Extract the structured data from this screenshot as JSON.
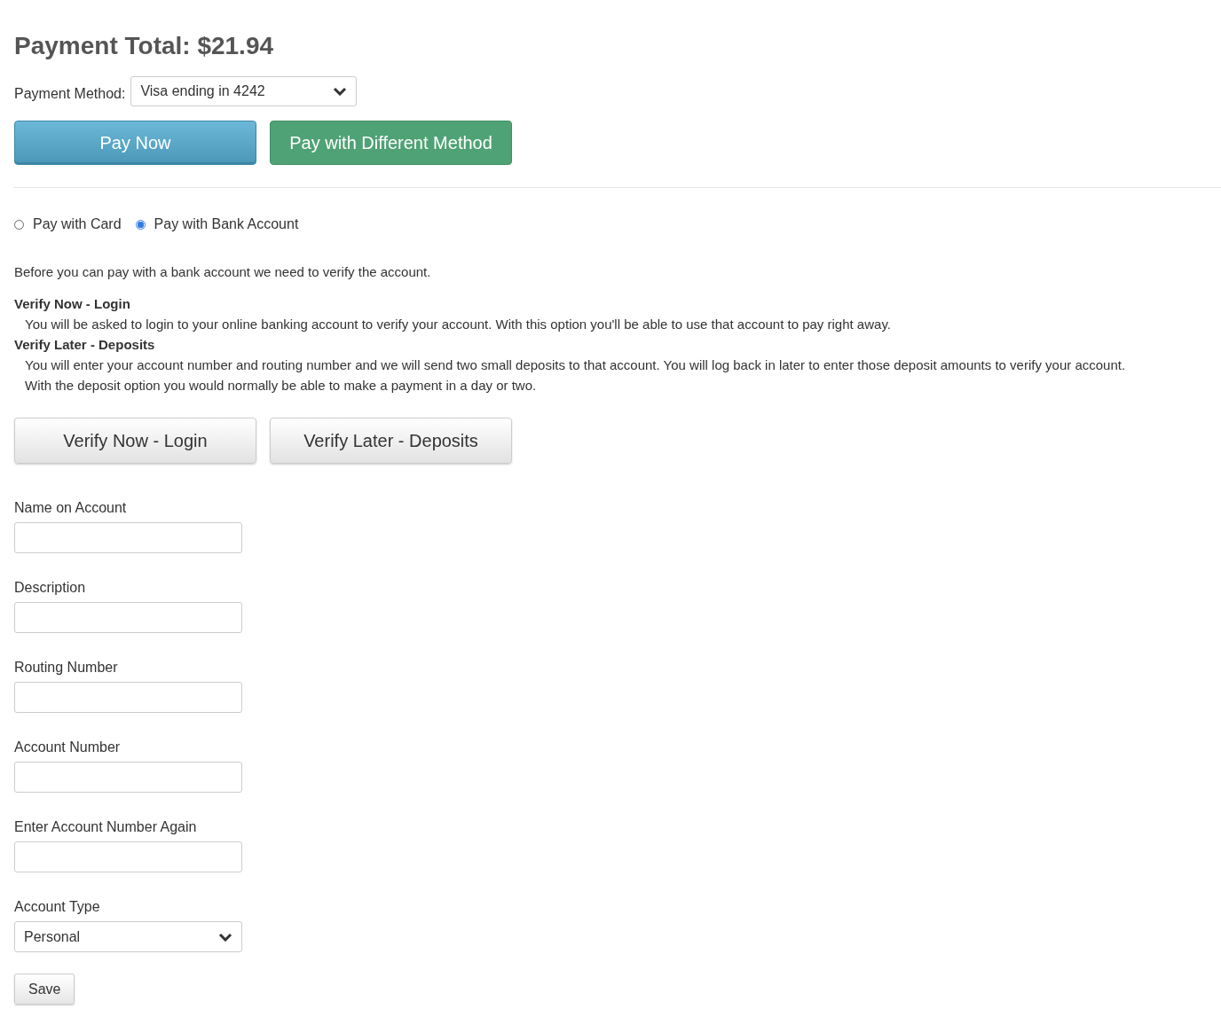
{
  "title": "Payment Total: $21.94",
  "payment_method": {
    "label": "Payment Method:",
    "value": "Visa ending in 4242"
  },
  "pay_buttons": [
    {
      "label": "Pay Now",
      "kind": "primary"
    },
    {
      "label": "Pay with Different Method",
      "kind": "success"
    }
  ],
  "pay_options": [
    {
      "label": "Pay with Card",
      "selected": false
    },
    {
      "label": "Pay with Bank Account",
      "selected": true
    }
  ],
  "intro": "Before you can pay with a bank account we need to verify the account.",
  "options": [
    {
      "heading": "Verify Now - Login",
      "lines": [
        "You will be asked to login to your online banking account to verify your account. With this option you'll be able to use that account to pay right away."
      ]
    },
    {
      "heading": "Verify Later - Deposits",
      "lines": [
        "You will enter your account number and routing number and we will send two small deposits to that account. You will log back in later to enter those deposit amounts to verify your account.",
        "With the deposit option you would normally be able to make a payment in a day or two."
      ]
    }
  ],
  "verify_buttons": [
    "Verify Now - Login",
    "Verify Later - Deposits"
  ],
  "fields": [
    {
      "label": "Name on Account",
      "kind": "text"
    },
    {
      "label": "Description",
      "kind": "text"
    },
    {
      "label": "Routing Number",
      "kind": "text"
    },
    {
      "label": "Account Number",
      "kind": "text"
    },
    {
      "label": "Enter Account Number Again",
      "kind": "text"
    },
    {
      "label": "Account Type",
      "kind": "select",
      "value": "Personal"
    }
  ],
  "save_button": "Save"
}
